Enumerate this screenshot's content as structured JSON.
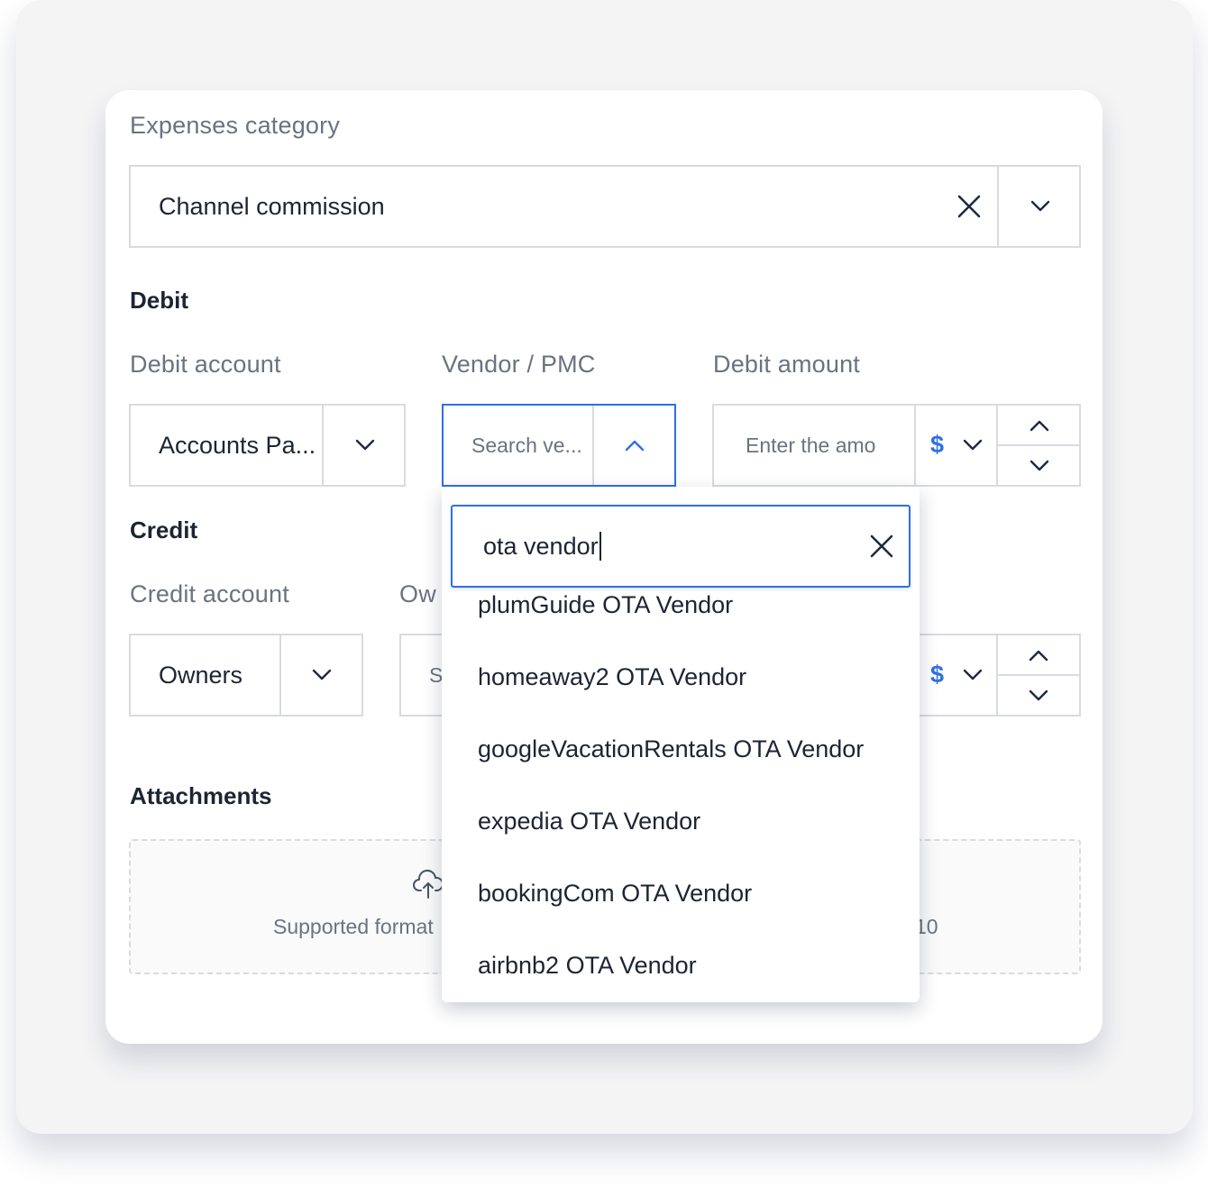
{
  "expenses_category": {
    "label": "Expenses category",
    "value": "Channel commission"
  },
  "debit": {
    "section_title": "Debit",
    "account_label": "Debit account",
    "account_value": "Accounts Pa...",
    "vendor_label": "Vendor / PMC",
    "vendor_placeholder": "Search ve...",
    "amount_label": "Debit amount",
    "amount_placeholder": "Enter the amo",
    "currency_symbol": "$"
  },
  "credit": {
    "section_title": "Credit",
    "account_label": "Credit account",
    "account_value": "Owners",
    "owner_label_partial": "Ow",
    "owner_placeholder_partial": "S",
    "currency_symbol": "$"
  },
  "attachments": {
    "section_title": "Attachments",
    "supported_text_partial": "Supported format",
    "supported_suffix_partial": "10"
  },
  "vendor_dropdown": {
    "search_value": "ota vendor",
    "items": [
      "plumGuide OTA Vendor",
      "homeaway2 OTA Vendor",
      "googleVacationRentals OTA Vendor",
      "expedia OTA Vendor",
      "bookingCom OTA Vendor",
      "airbnb2 OTA Vendor"
    ]
  },
  "colors": {
    "accent": "#2f6fe4",
    "border": "#d8dbe0",
    "label": "#6b7280",
    "text": "#1d2433"
  }
}
